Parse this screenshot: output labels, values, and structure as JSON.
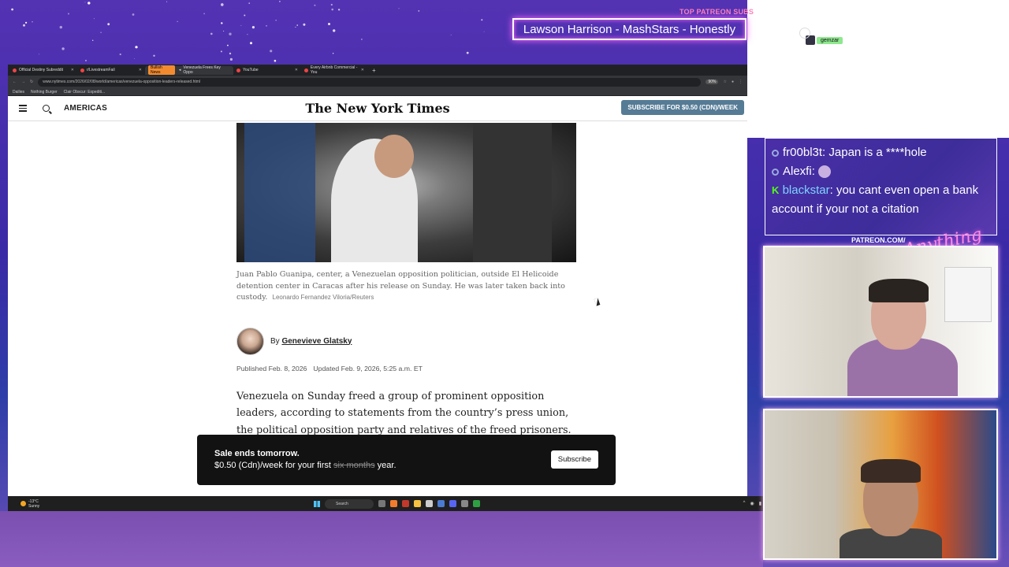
{
  "overlay": {
    "patreon_top": "TOP PATREON SUBS",
    "now_playing": "Lawson Harrison - MashStars - Honestly",
    "chat_user_badge": "gemzar",
    "patreon_cam_label": "PATREON.COM/",
    "anything_else": "Anything Else"
  },
  "browser": {
    "tabs": [
      {
        "label": "Official Destiny Subreddit"
      },
      {
        "label": "r/LivestreamFail"
      },
      {
        "label": "Venezuela Frees Key Oppo",
        "tag": "Bullish News"
      },
      {
        "label": "YouTube"
      },
      {
        "label": "Every Airbnb Commercial - You"
      }
    ],
    "url": "www.nytimes.com/2026/02/08/world/americas/venezuela-opposition-leaders-released.html",
    "zoom": "90%",
    "bookmarks": [
      "Dailies",
      "Nothing Burger",
      "Clair Obscur: Expediti..."
    ]
  },
  "nyt": {
    "section": "AMERICAS",
    "logo": "The New York Times",
    "subscribe": "SUBSCRIBE FOR $0.50 (CDN)/WEEK",
    "caption": "Juan Pablo Guanipa, center, a Venezuelan opposition politician, outside El Helicoide detention center in Caracas after his release on Sunday. He was later taken back into custody.",
    "credit": "Leonardo Fernandez Viloria/Reuters",
    "by_prefix": "By",
    "author": "Genevieve Glatsky",
    "published": "Published Feb. 8, 2026",
    "updated": "Updated Feb. 9, 2026, 5:25 a.m. ET",
    "body": "Venezuela on Sunday freed a group of prominent opposition leaders, according to statements from the country’s press union, the political opposition party and relatives of the freed prisoners.",
    "banner": {
      "title": "Sale ends tomorrow.",
      "line_a": "$0.50 (Cdn)/week for your first",
      "line_strike": "six months",
      "line_b": "year.",
      "button": "Subscribe"
    }
  },
  "taskbar": {
    "temp": "-13°C",
    "weather": "Sunny",
    "search": "Search"
  },
  "chat": [
    {
      "user": "fr00bl3t",
      "text": "Japan is a ****hole",
      "platform": "twitch"
    },
    {
      "user": "Alexfi",
      "text": "",
      "emote": true,
      "platform": "twitch"
    },
    {
      "user": "blackstar",
      "text": "you cant even open a bank account if your not a citation",
      "platform": "kick"
    }
  ],
  "colors": {
    "subscribe_bg": "#567b95",
    "banner_bg": "#121212",
    "overlay_purple": "#4a2ea8"
  }
}
